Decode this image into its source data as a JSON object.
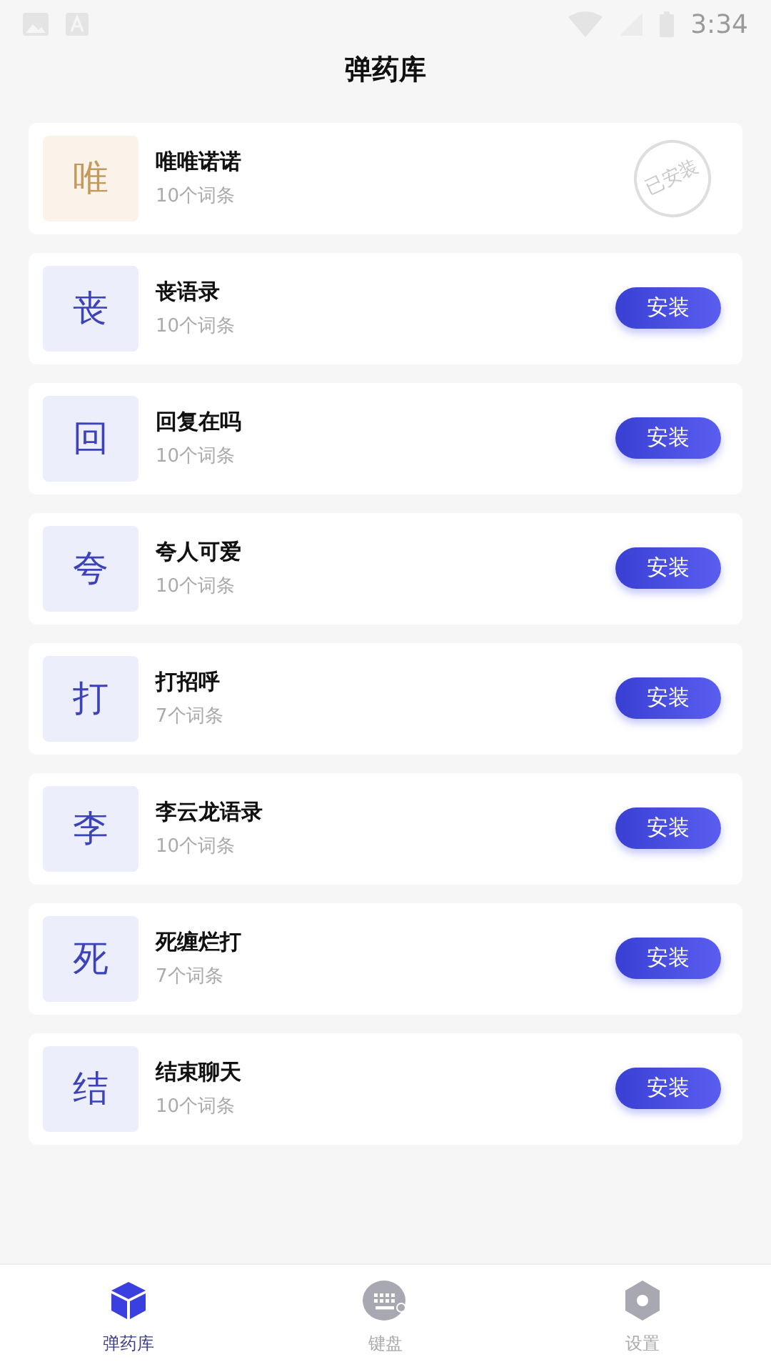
{
  "status_bar": {
    "time": "3:34"
  },
  "title": "弹药库",
  "packs": [
    {
      "initial": "唯",
      "name": "唯唯诺诺",
      "count": "10个词条",
      "installed": true,
      "action": "已安装"
    },
    {
      "initial": "丧",
      "name": "丧语录",
      "count": "10个词条",
      "installed": false,
      "action": "安装"
    },
    {
      "initial": "回",
      "name": "回复在吗",
      "count": "10个词条",
      "installed": false,
      "action": "安装"
    },
    {
      "initial": "夸",
      "name": "夸人可爱",
      "count": "10个词条",
      "installed": false,
      "action": "安装"
    },
    {
      "initial": "打",
      "name": "打招呼",
      "count": "7个词条",
      "installed": false,
      "action": "安装"
    },
    {
      "initial": "李",
      "name": "李云龙语录",
      "count": "10个词条",
      "installed": false,
      "action": "安装"
    },
    {
      "initial": "死",
      "name": "死缠烂打",
      "count": "7个词条",
      "installed": false,
      "action": "安装"
    },
    {
      "initial": "结",
      "name": "结束聊天",
      "count": "10个词条",
      "installed": false,
      "action": "安装"
    }
  ],
  "tabs": [
    {
      "label": "弹药库",
      "kind": "cube",
      "selected": true
    },
    {
      "label": "键盘",
      "kind": "keyboard",
      "selected": false
    },
    {
      "label": "设置",
      "kind": "settings",
      "selected": false
    }
  ]
}
